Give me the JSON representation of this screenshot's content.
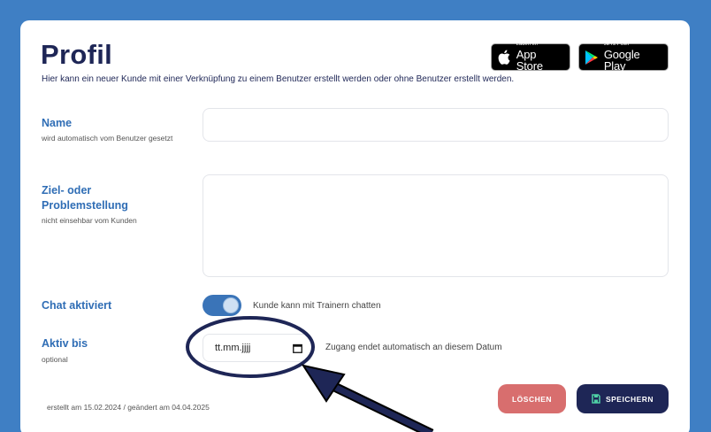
{
  "header": {
    "title": "Profil",
    "subtitle": "Hier kann ein neuer Kunde mit einer Verknüpfung zu einem Benutzer erstellt werden oder ohne Benutzer erstellt werden."
  },
  "badges": {
    "appstore": {
      "small": "Laden im",
      "big": "App Store"
    },
    "googleplay": {
      "small": "JETZT BEI",
      "big": "Google Play"
    }
  },
  "form": {
    "name": {
      "label": "Name",
      "hint": "wird automatisch vom Benutzer gesetzt",
      "value": ""
    },
    "goal": {
      "label": "Ziel- oder Problemstellung",
      "hint": "nicht einsehbar vom Kunden",
      "value": ""
    },
    "chat": {
      "label": "Chat aktiviert",
      "enabled": true,
      "description": "Kunde kann mit Trainern chatten"
    },
    "active_until": {
      "label": "Aktiv bis",
      "hint": "optional",
      "placeholder": "tt.mm.jjjj",
      "description": "Zugang endet automatisch an diesem Datum"
    }
  },
  "footer": {
    "meta": "erstellt am 15.02.2024  /  geändert am 04.04.2025",
    "delete_label": "LÖSCHEN",
    "save_label": "SPEICHERN"
  },
  "colors": {
    "background": "#3f7fc4",
    "title": "#1e2656",
    "label": "#2f6db5",
    "delete": "#d86e6e",
    "save": "#1e2656",
    "toggle": "#3a74b8"
  }
}
